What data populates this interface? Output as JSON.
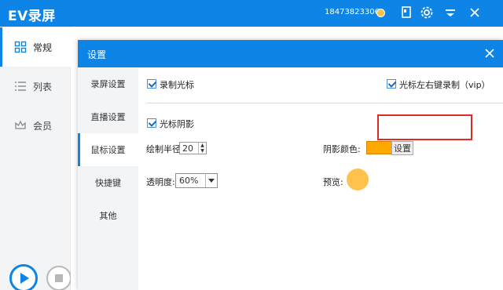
{
  "app": {
    "title": "EV录屏",
    "phone": "18473823306"
  },
  "sidebar": {
    "items": [
      {
        "label": "常规",
        "icon": "grid-icon"
      },
      {
        "label": "列表",
        "icon": "list-icon"
      },
      {
        "label": "会员",
        "icon": "crown-icon"
      }
    ]
  },
  "dialog": {
    "title": "设置",
    "tabs": [
      "录屏设置",
      "直播设置",
      "鼠标设置",
      "快捷键",
      "其他"
    ],
    "active_tab": "鼠标设置",
    "mouse": {
      "record_cursor_label": "录制光标",
      "record_cursor_checked": true,
      "record_clicks_label": "光标左右键录制（vip）",
      "record_clicks_checked": true,
      "cursor_shadow_label": "光标阴影",
      "cursor_shadow_checked": true,
      "radius_label": "绘制半径:",
      "radius_value": "20",
      "shadow_color_label": "阴影颜色:",
      "shadow_color": "#ffa800",
      "set_button": "设置",
      "opacity_label": "透明度:",
      "opacity_value": "60%",
      "preview_label": "预览:"
    }
  },
  "colors": {
    "accent": "#0d84e6",
    "highlight": "#e02b24"
  }
}
